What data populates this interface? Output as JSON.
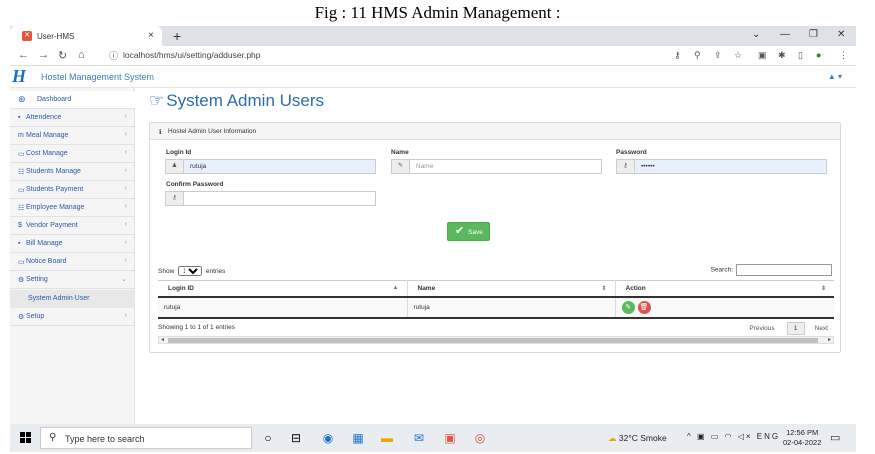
{
  "caption": "Fig : 11 HMS Admin Management :",
  "browser": {
    "tab_title": "User-HMS",
    "tab_close": "×",
    "new_tab": "+",
    "url": "localhost/hms/ui/setting/adduser.php",
    "win_minimize": "—",
    "win_restore": "❐",
    "win_close": "✕",
    "win_chevron": "⌄"
  },
  "app": {
    "logo": "H",
    "brand": "Hostel Management System",
    "user_menu": "▲ ▾"
  },
  "sidebar": {
    "items": [
      {
        "label": "Dashboard",
        "icon": "⊛"
      },
      {
        "label": "Attendence",
        "icon": "▪"
      },
      {
        "label": "Meal Manage",
        "icon": "m"
      },
      {
        "label": "Cost Manage",
        "icon": "▭"
      },
      {
        "label": "Students Manage",
        "icon": "☷"
      },
      {
        "label": "Students Payment",
        "icon": "▭"
      },
      {
        "label": "Employee Manage",
        "icon": "☷"
      },
      {
        "label": "Vendor Payment",
        "icon": "$"
      },
      {
        "label": "Bill Manage",
        "icon": "▪"
      },
      {
        "label": "Notice Board",
        "icon": "▭"
      },
      {
        "label": "Setting",
        "icon": "⚙"
      }
    ],
    "sub_item": "System Admin User",
    "last_item": {
      "label": "Setup",
      "icon": "⚙"
    }
  },
  "page": {
    "title": "System Admin Users",
    "panel_title": "Hostel Admin User Information",
    "form": {
      "login_label": "Login Id",
      "login_value": "rutuja",
      "name_label": "Name",
      "name_placeholder": "Name",
      "password_label": "Password",
      "password_value": "••••••",
      "confirm_label": "Confirm Password",
      "confirm_value": ""
    },
    "save_label": "Save"
  },
  "table": {
    "show_prefix": "Show",
    "show_value": "10",
    "show_suffix": "entries",
    "search_label": "Search:",
    "headers": [
      "Login ID",
      "Name",
      "Action"
    ],
    "rows": [
      {
        "login": "rutuja",
        "name": "rutuja"
      }
    ],
    "info": "Showing 1 to 1 of 1 entries",
    "prev": "Previous",
    "page": "1",
    "next": "Next"
  },
  "taskbar": {
    "search_placeholder": "Type here to search",
    "weather": "32°C  Smoke",
    "tray": "^ ▣ ▭ ◠ ◁× ENG",
    "time": "12:56 PM",
    "date": "02-04-2022"
  }
}
